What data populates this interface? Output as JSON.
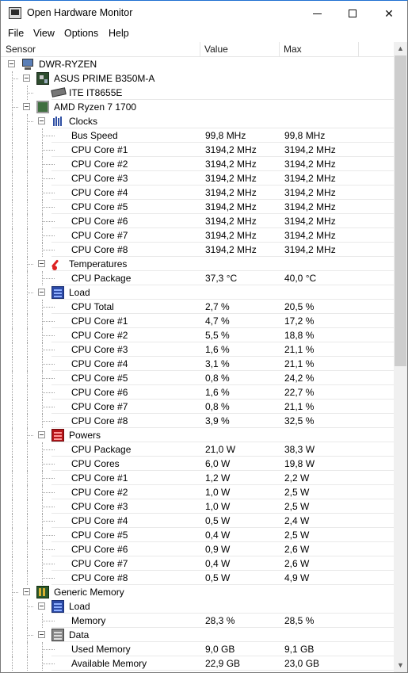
{
  "window": {
    "title": "Open Hardware Monitor"
  },
  "menu": [
    "File",
    "View",
    "Options",
    "Help"
  ],
  "columns": {
    "sensor": "Sensor",
    "value": "Value",
    "max": "Max"
  },
  "tree": [
    {
      "kind": "computer",
      "name": "DWR-RYZEN"
    },
    {
      "kind": "board",
      "name": "ASUS PRIME B350M-A"
    },
    {
      "kind": "chip",
      "name": "ITE IT8655E"
    },
    {
      "kind": "cpu",
      "name": "AMD Ryzen 7 1700"
    },
    {
      "kind": "clock",
      "name": "Clocks"
    },
    {
      "kind": "sensor",
      "name": "Bus Speed",
      "value": "99,8 MHz",
      "max": "99,8 MHz"
    },
    {
      "kind": "sensor",
      "name": "CPU Core #1",
      "value": "3194,2 MHz",
      "max": "3194,2 MHz"
    },
    {
      "kind": "sensor",
      "name": "CPU Core #2",
      "value": "3194,2 MHz",
      "max": "3194,2 MHz"
    },
    {
      "kind": "sensor",
      "name": "CPU Core #3",
      "value": "3194,2 MHz",
      "max": "3194,2 MHz"
    },
    {
      "kind": "sensor",
      "name": "CPU Core #4",
      "value": "3194,2 MHz",
      "max": "3194,2 MHz"
    },
    {
      "kind": "sensor",
      "name": "CPU Core #5",
      "value": "3194,2 MHz",
      "max": "3194,2 MHz"
    },
    {
      "kind": "sensor",
      "name": "CPU Core #6",
      "value": "3194,2 MHz",
      "max": "3194,2 MHz"
    },
    {
      "kind": "sensor",
      "name": "CPU Core #7",
      "value": "3194,2 MHz",
      "max": "3194,2 MHz"
    },
    {
      "kind": "sensor",
      "name": "CPU Core #8",
      "value": "3194,2 MHz",
      "max": "3194,2 MHz"
    },
    {
      "kind": "temp",
      "name": "Temperatures"
    },
    {
      "kind": "sensor",
      "name": "CPU Package",
      "value": "37,3 °C",
      "max": "40,0 °C"
    },
    {
      "kind": "load",
      "name": "Load"
    },
    {
      "kind": "sensor",
      "name": "CPU Total",
      "value": "2,7 %",
      "max": "20,5 %"
    },
    {
      "kind": "sensor",
      "name": "CPU Core #1",
      "value": "4,7 %",
      "max": "17,2 %"
    },
    {
      "kind": "sensor",
      "name": "CPU Core #2",
      "value": "5,5 %",
      "max": "18,8 %"
    },
    {
      "kind": "sensor",
      "name": "CPU Core #3",
      "value": "1,6 %",
      "max": "21,1 %"
    },
    {
      "kind": "sensor",
      "name": "CPU Core #4",
      "value": "3,1 %",
      "max": "21,1 %"
    },
    {
      "kind": "sensor",
      "name": "CPU Core #5",
      "value": "0,8 %",
      "max": "24,2 %"
    },
    {
      "kind": "sensor",
      "name": "CPU Core #6",
      "value": "1,6 %",
      "max": "22,7 %"
    },
    {
      "kind": "sensor",
      "name": "CPU Core #7",
      "value": "0,8 %",
      "max": "21,1 %"
    },
    {
      "kind": "sensor",
      "name": "CPU Core #8",
      "value": "3,9 %",
      "max": "32,5 %"
    },
    {
      "kind": "power",
      "name": "Powers"
    },
    {
      "kind": "sensor",
      "name": "CPU Package",
      "value": "21,0 W",
      "max": "38,3 W"
    },
    {
      "kind": "sensor",
      "name": "CPU Cores",
      "value": "6,0 W",
      "max": "19,8 W"
    },
    {
      "kind": "sensor",
      "name": "CPU Core #1",
      "value": "1,2 W",
      "max": "2,2 W"
    },
    {
      "kind": "sensor",
      "name": "CPU Core #2",
      "value": "1,0 W",
      "max": "2,5 W"
    },
    {
      "kind": "sensor",
      "name": "CPU Core #3",
      "value": "1,0 W",
      "max": "2,5 W"
    },
    {
      "kind": "sensor",
      "name": "CPU Core #4",
      "value": "0,5 W",
      "max": "2,4 W"
    },
    {
      "kind": "sensor",
      "name": "CPU Core #5",
      "value": "0,4 W",
      "max": "2,5 W"
    },
    {
      "kind": "sensor",
      "name": "CPU Core #6",
      "value": "0,9 W",
      "max": "2,6 W"
    },
    {
      "kind": "sensor",
      "name": "CPU Core #7",
      "value": "0,4 W",
      "max": "2,6 W"
    },
    {
      "kind": "sensor",
      "name": "CPU Core #8",
      "value": "0,5 W",
      "max": "4,9 W"
    },
    {
      "kind": "memory",
      "name": "Generic Memory"
    },
    {
      "kind": "load",
      "name": "Load"
    },
    {
      "kind": "sensor",
      "name": "Memory",
      "value": "28,3 %",
      "max": "28,5 %"
    },
    {
      "kind": "data",
      "name": "Data"
    },
    {
      "kind": "sensor",
      "name": "Used Memory",
      "value": "9,0 GB",
      "max": "9,1 GB"
    },
    {
      "kind": "sensor",
      "name": "Available Memory",
      "value": "22,9 GB",
      "max": "23,0 GB"
    }
  ]
}
